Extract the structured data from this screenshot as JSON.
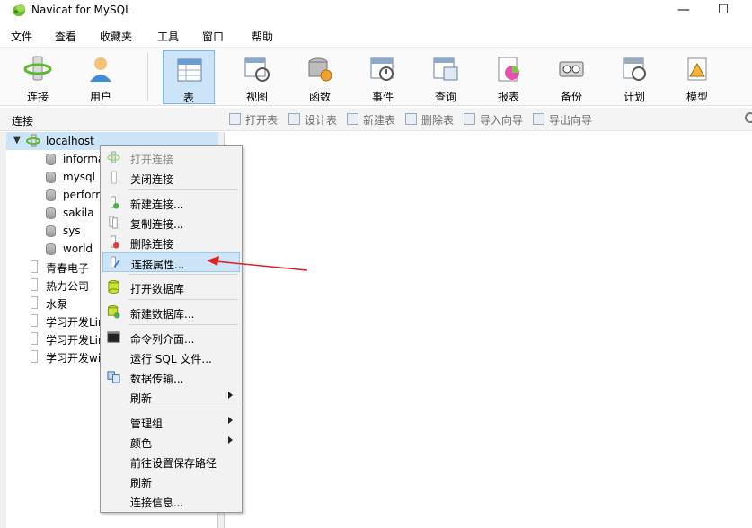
{
  "window": {
    "title": "Navicat for MySQL",
    "minimize_glyph": "—",
    "maximize_glyph": "☐"
  },
  "menubar": {
    "items": [
      "文件",
      "查看",
      "收藏夹",
      "工具",
      "窗口",
      "帮助"
    ]
  },
  "toolbar": {
    "items": [
      {
        "label": "连接",
        "icon": "connection-icon"
      },
      {
        "label": "用户",
        "icon": "user-icon"
      },
      {
        "label": "表",
        "icon": "table-icon",
        "active": true
      },
      {
        "label": "视图",
        "icon": "view-icon"
      },
      {
        "label": "函数",
        "icon": "function-icon"
      },
      {
        "label": "事件",
        "icon": "event-icon"
      },
      {
        "label": "查询",
        "icon": "query-icon"
      },
      {
        "label": "报表",
        "icon": "report-icon"
      },
      {
        "label": "备份",
        "icon": "backup-icon"
      },
      {
        "label": "计划",
        "icon": "schedule-icon"
      },
      {
        "label": "模型",
        "icon": "model-icon"
      }
    ]
  },
  "subbar": {
    "connection_label": "连接",
    "actions": [
      "打开表",
      "设计表",
      "新建表",
      "删除表",
      "导入向导",
      "导出向导"
    ]
  },
  "tree": {
    "root": "localhost",
    "databases": [
      "informa",
      "mysql",
      "perforr",
      "sakila",
      "sys",
      "world"
    ],
    "connections": [
      "青春电子",
      "热力公司",
      "水泵",
      "学习开发Lin",
      "学习开发Lin",
      "学习开发wi"
    ]
  },
  "context_menu": {
    "items": [
      {
        "label": "打开连接",
        "disabled": true
      },
      {
        "label": "关闭连接"
      },
      {
        "label": "新建连接..."
      },
      {
        "label": "复制连接..."
      },
      {
        "label": "删除连接"
      },
      {
        "label": "连接属性...",
        "highlighted": true
      },
      {
        "label": "打开数据库"
      },
      {
        "label": "新建数据库..."
      },
      {
        "label": "命令列介面..."
      },
      {
        "label": "运行 SQL 文件..."
      },
      {
        "label": "数据传输..."
      },
      {
        "label": "刷新",
        "submenu": true
      },
      {
        "label": "管理组",
        "submenu": true
      },
      {
        "label": "颜色",
        "submenu": true
      },
      {
        "label": "前往设置保存路径"
      },
      {
        "label": "刷新"
      },
      {
        "label": "连接信息..."
      }
    ]
  },
  "colors": {
    "selection": "#cce4f7",
    "annotation_arrow": "#e02020"
  }
}
